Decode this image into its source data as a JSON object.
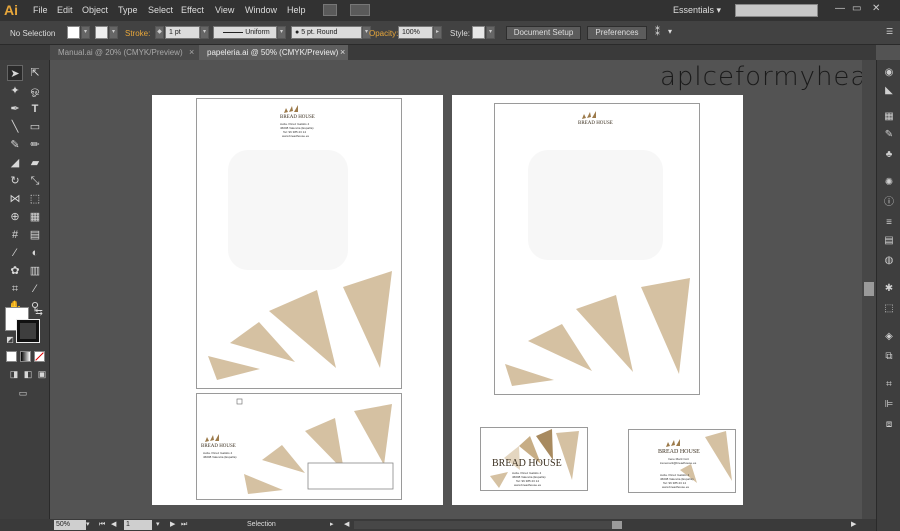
{
  "app": {
    "logo": "Ai",
    "workspace": "Essentials"
  },
  "menus": [
    "File",
    "Edit",
    "Object",
    "Type",
    "Select",
    "Effect",
    "View",
    "Window",
    "Help"
  ],
  "control": {
    "selection": "No Selection",
    "stroke_label": "Stroke:",
    "stroke_weight": "1 pt",
    "stroke_profile": "Uniform",
    "brush": "5 pt. Round",
    "opacity_label": "Opacity:",
    "opacity": "100%",
    "style_label": "Style:",
    "doc_setup": "Document Setup",
    "preferences": "Preferences"
  },
  "tabs": [
    {
      "label": "Manual.ai @ 20% (CMYK/Preview)",
      "close": "×"
    },
    {
      "label": "papeleria.ai @ 50% (CMYK/Preview)",
      "close": "×"
    }
  ],
  "watermark": "aplceformyhead",
  "brand": {
    "name": "BREAD HOUSE",
    "address1": "Avda. Pérez Galdós 4",
    "address2": "46008 Valencia (España)",
    "tel": "Tel: 96 385 23 14",
    "web": "www.breadhouse.es",
    "person_name": "Irene Martí Cort",
    "person_email": "irenemarti@breadhouse.es",
    "accent_color": "#d5c1a2",
    "accent_dark": "#9c7a4a"
  },
  "status": {
    "zoom": "50%",
    "page": "1",
    "mode": "Selection"
  }
}
